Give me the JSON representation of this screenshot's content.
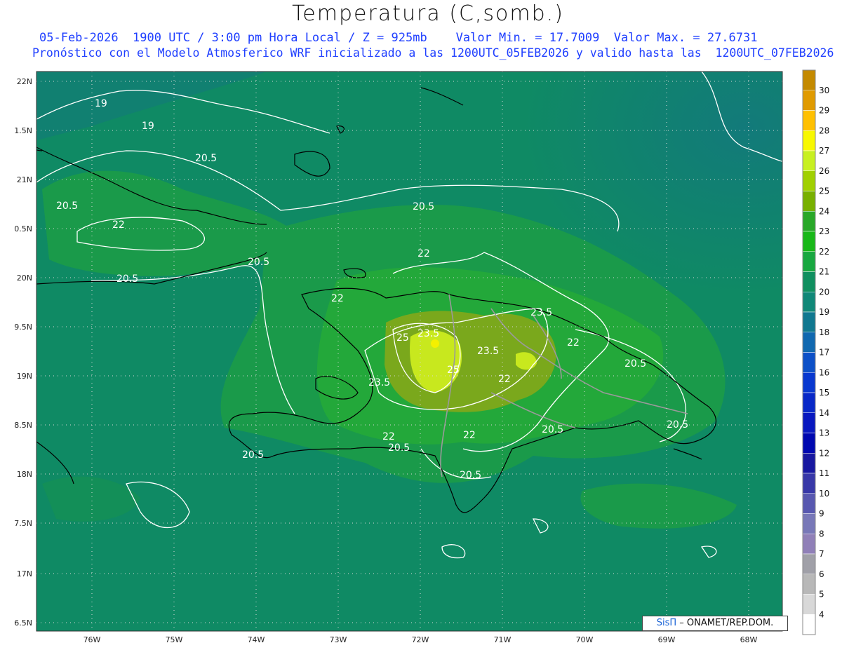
{
  "header": {
    "title": "Temperatura (C,somb.)",
    "subtitle1": "05-Feb-2026  1900 UTC / 3:00 pm Hora Local / Z = 925mb    Valor Min. = 17.7009  Valor Max. = 27.6731",
    "subtitle2": "Pronóstico con el Modelo Atmosferico WRF inicializado a las 1200UTC_05FEB2026 y valido hasta las  1200UTC_07FEB2026"
  },
  "map": {
    "lat_labels": [
      "22N",
      "1.5N",
      "21N",
      "0.5N",
      "20N",
      "9.5N",
      "19N",
      "8.5N",
      "18N",
      "7.5N",
      "17N",
      "6.5N"
    ],
    "lon_labels": [
      "76W",
      "75W",
      "74W",
      "73W",
      "72W",
      "71W",
      "70W",
      "69W",
      "68W"
    ],
    "contour_labels": [
      "19",
      "19",
      "20.5",
      "20.5",
      "22",
      "20.5",
      "20.5",
      "20.5",
      "22",
      "22",
      "23.5",
      "25",
      "23.5",
      "23.5",
      "25",
      "22",
      "23.5",
      "22",
      "20.5",
      "22",
      "20.5",
      "20.5",
      "22",
      "20.5",
      "20.5",
      "20.5"
    ],
    "colors": {
      "ocean": "#0f8a64",
      "ocean_ne": "#127a7a",
      "land_low": "#1a9a4a",
      "land_mid": "#23a83a",
      "land_hi": "#7aa81c",
      "peak": "#c8e81e",
      "contour": "#ffffff",
      "coast": "#000000",
      "border": "#9a9a9a"
    }
  },
  "colorbar": {
    "labels": [
      "30",
      "29",
      "28",
      "27",
      "26",
      "25",
      "24",
      "23",
      "22",
      "21",
      "20",
      "19",
      "18",
      "17",
      "16",
      "15",
      "14",
      "13",
      "12",
      "11",
      "10",
      "9",
      "8",
      "7",
      "6",
      "5",
      "4"
    ],
    "colors": [
      "#c48a00",
      "#e09a00",
      "#ffc000",
      "#f8f800",
      "#c8f020",
      "#a0d000",
      "#78b000",
      "#28a828",
      "#18b818",
      "#18a840",
      "#109060",
      "#108878",
      "#107890",
      "#1068b0",
      "#0c50c8",
      "#0838d0",
      "#0828c8",
      "#0818c0",
      "#0008b0",
      "#1818a0",
      "#3838a8",
      "#5858b0",
      "#7878b8",
      "#9080b8",
      "#a0a0a8",
      "#b8b8b8",
      "#d8d8d8",
      "#ffffff"
    ]
  },
  "credit": {
    "brand": "SisΠ",
    "text": " – ONAMET/REP.DOM."
  }
}
